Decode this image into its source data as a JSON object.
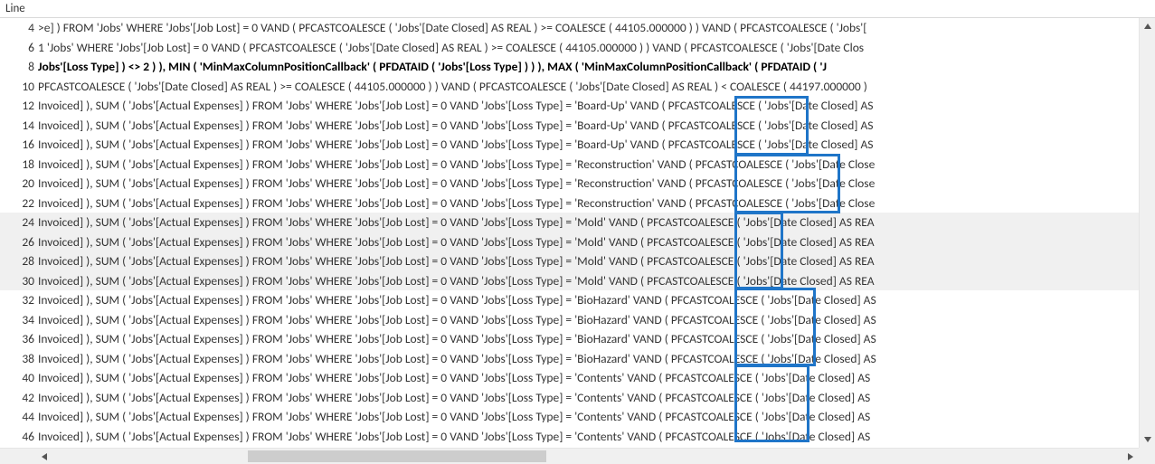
{
  "header": {
    "column_label": "Line"
  },
  "rows": [
    {
      "n": 4,
      "text": ">e] ) FROM 'Jobs' WHERE 'Jobs'[Job Lost] = 0 VAND  ( PFCASTCOALESCE ( 'Jobs'[Date Closed] AS  REAL ) >= COALESCE ( 44105.000000 )  ) VAND  ( PFCASTCOALESCE ( 'Jobs'["
    },
    {
      "n": 6,
      "text": "1 'Jobs' WHERE 'Jobs'[Job Lost] = 0 VAND  ( PFCASTCOALESCE ( 'Jobs'[Date Closed] AS  REAL ) >= COALESCE ( 44105.000000 )  ) VAND  ( PFCASTCOALESCE ( 'Jobs'[Date Clos"
    },
    {
      "n": 8,
      "bold": true,
      "text": "Jobs'[Loss Type] ) <> 2 )  ), MIN ( 'MinMaxColumnPositionCallback' ( PFDATAID ( 'Jobs'[Loss Type] )  )  ), MAX ( 'MinMaxColumnPositionCallback' ( PFDATAID ( 'J"
    },
    {
      "n": 10,
      "text": "PFCASTCOALESCE ( 'Jobs'[Date Closed] AS  REAL ) >= COALESCE ( 44105.000000 )  ) VAND  ( PFCASTCOALESCE ( 'Jobs'[Date Closed] AS  REAL ) < COALESCE ( 44197.000000 )"
    },
    {
      "n": 12,
      "text": "Invoiced] ), SUM ( 'Jobs'[Actual Expenses] ) FROM 'Jobs' WHERE 'Jobs'[Job Lost] = 0 VAND 'Jobs'[Loss Type] = 'Board-Up' VAND  ( PFCASTCOALESCE ( 'Jobs'[Date Closed] AS"
    },
    {
      "n": 14,
      "text": "Invoiced] ), SUM ( 'Jobs'[Actual Expenses] ) FROM 'Jobs' WHERE 'Jobs'[Job Lost] = 0 VAND 'Jobs'[Loss Type] = 'Board-Up' VAND  ( PFCASTCOALESCE ( 'Jobs'[Date Closed] AS"
    },
    {
      "n": 16,
      "text": "Invoiced] ), SUM ( 'Jobs'[Actual Expenses] ) FROM 'Jobs' WHERE 'Jobs'[Job Lost] = 0 VAND 'Jobs'[Loss Type] = 'Board-Up' VAND  ( PFCASTCOALESCE ( 'Jobs'[Date Closed] AS"
    },
    {
      "n": 18,
      "text": "Invoiced] ), SUM ( 'Jobs'[Actual Expenses] ) FROM 'Jobs' WHERE 'Jobs'[Job Lost] = 0 VAND 'Jobs'[Loss Type] = 'Reconstruction' VAND  ( PFCASTCOALESCE ( 'Jobs'[Date Close"
    },
    {
      "n": 20,
      "text": "Invoiced] ), SUM ( 'Jobs'[Actual Expenses] ) FROM 'Jobs' WHERE 'Jobs'[Job Lost] = 0 VAND 'Jobs'[Loss Type] = 'Reconstruction' VAND  ( PFCASTCOALESCE ( 'Jobs'[Date Close"
    },
    {
      "n": 22,
      "text": "Invoiced] ), SUM ( 'Jobs'[Actual Expenses] ) FROM 'Jobs' WHERE 'Jobs'[Job Lost] = 0 VAND 'Jobs'[Loss Type] = 'Reconstruction' VAND  ( PFCASTCOALESCE ( 'Jobs'[Date Close"
    },
    {
      "n": 24,
      "alt": true,
      "text": "Invoiced] ), SUM ( 'Jobs'[Actual Expenses] ) FROM 'Jobs' WHERE 'Jobs'[Job Lost] = 0 VAND 'Jobs'[Loss Type] = 'Mold' VAND  ( PFCASTCOALESCE ( 'Jobs'[Date Closed] AS  REA"
    },
    {
      "n": 26,
      "alt": true,
      "text": "Invoiced] ), SUM ( 'Jobs'[Actual Expenses] ) FROM 'Jobs' WHERE 'Jobs'[Job Lost] = 0 VAND 'Jobs'[Loss Type] = 'Mold' VAND  ( PFCASTCOALESCE ( 'Jobs'[Date Closed] AS  REA"
    },
    {
      "n": 28,
      "alt": true,
      "text": "Invoiced] ), SUM ( 'Jobs'[Actual Expenses] ) FROM 'Jobs' WHERE 'Jobs'[Job Lost] = 0 VAND 'Jobs'[Loss Type] = 'Mold' VAND  ( PFCASTCOALESCE ( 'Jobs'[Date Closed] AS  REA"
    },
    {
      "n": 30,
      "alt": true,
      "text": "Invoiced] ), SUM ( 'Jobs'[Actual Expenses] ) FROM 'Jobs' WHERE 'Jobs'[Job Lost] = 0 VAND 'Jobs'[Loss Type] = 'Mold' VAND  ( PFCASTCOALESCE ( 'Jobs'[Date Closed] AS  REA"
    },
    {
      "n": 32,
      "text": "Invoiced] ), SUM ( 'Jobs'[Actual Expenses] ) FROM 'Jobs' WHERE 'Jobs'[Job Lost] = 0 VAND 'Jobs'[Loss Type] = 'BioHazard' VAND  ( PFCASTCOALESCE ( 'Jobs'[Date Closed] AS"
    },
    {
      "n": 34,
      "text": "Invoiced] ), SUM ( 'Jobs'[Actual Expenses] ) FROM 'Jobs' WHERE 'Jobs'[Job Lost] = 0 VAND 'Jobs'[Loss Type] = 'BioHazard' VAND  ( PFCASTCOALESCE ( 'Jobs'[Date Closed] AS"
    },
    {
      "n": 36,
      "text": "Invoiced] ), SUM ( 'Jobs'[Actual Expenses] ) FROM 'Jobs' WHERE 'Jobs'[Job Lost] = 0 VAND 'Jobs'[Loss Type] = 'BioHazard' VAND  ( PFCASTCOALESCE ( 'Jobs'[Date Closed] AS"
    },
    {
      "n": 38,
      "text": "Invoiced] ), SUM ( 'Jobs'[Actual Expenses] ) FROM 'Jobs' WHERE 'Jobs'[Job Lost] = 0 VAND 'Jobs'[Loss Type] = 'BioHazard' VAND  ( PFCASTCOALESCE ( 'Jobs'[Date Closed] AS"
    },
    {
      "n": 40,
      "text": "Invoiced] ), SUM ( 'Jobs'[Actual Expenses] ) FROM 'Jobs' WHERE 'Jobs'[Job Lost] = 0 VAND 'Jobs'[Loss Type] = 'Contents' VAND  ( PFCASTCOALESCE ( 'Jobs'[Date Closed] AS"
    },
    {
      "n": 42,
      "text": "Invoiced] ), SUM ( 'Jobs'[Actual Expenses] ) FROM 'Jobs' WHERE 'Jobs'[Job Lost] = 0 VAND 'Jobs'[Loss Type] = 'Contents' VAND  ( PFCASTCOALESCE ( 'Jobs'[Date Closed] AS"
    },
    {
      "n": 44,
      "text": "Invoiced] ), SUM ( 'Jobs'[Actual Expenses] ) FROM 'Jobs' WHERE 'Jobs'[Job Lost] = 0 VAND 'Jobs'[Loss Type] = 'Contents' VAND  ( PFCASTCOALESCE ( 'Jobs'[Date Closed] AS"
    },
    {
      "n": 46,
      "text": "Invoiced] ), SUM ( 'Jobs'[Actual Expenses] ) FROM 'Jobs' WHERE 'Jobs'[Job Lost] = 0 VAND 'Jobs'[Loss Type] = 'Contents' VAND  ( PFCASTCOALESCE ( 'Jobs'[Date Closed] AS"
    }
  ],
  "highlight_groups": [
    {
      "label": "Board-Up"
    },
    {
      "label": "Reconstruction"
    },
    {
      "label": "Mold"
    },
    {
      "label": "BioHazard"
    },
    {
      "label": "Contents"
    }
  ]
}
